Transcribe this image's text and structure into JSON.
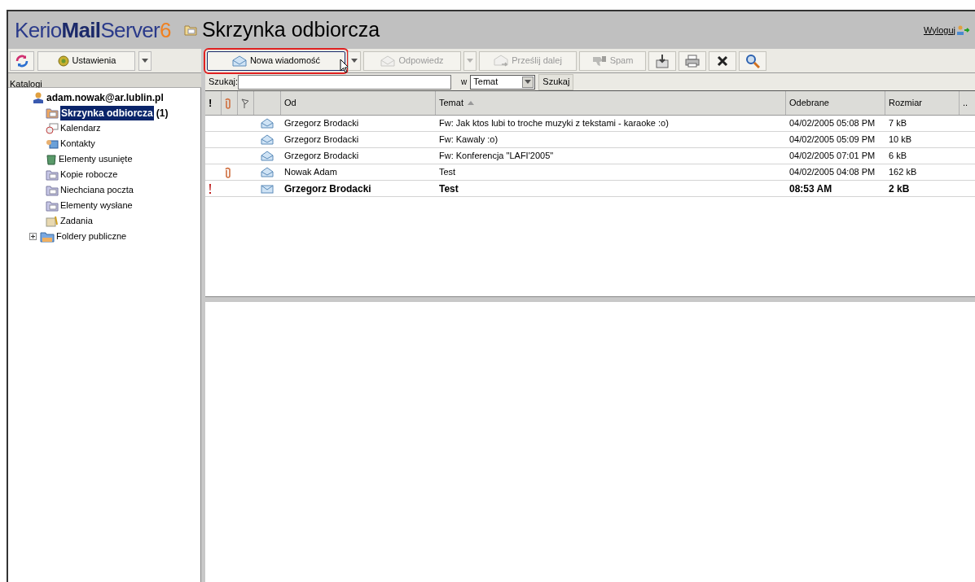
{
  "header": {
    "logo": [
      {
        "text": "Kerio",
        "kind": "plain"
      },
      {
        "text": "Mail",
        "kind": "stylized"
      },
      {
        "text": "Server",
        "kind": "plain"
      },
      {
        "text": "6",
        "kind": "accent"
      }
    ],
    "title": "Skrzynka odbiorcza",
    "logout": "Wyloguj"
  },
  "sidebar": {
    "toolbar": [
      {
        "kind": "refresh"
      },
      {
        "kind": "settings",
        "label": "Ustawienia"
      },
      {
        "kind": "dropdown"
      }
    ],
    "header": "Katalogi",
    "tree": {
      "label": "adam.nowak@ar.lublin.pl",
      "children": [
        {
          "label": "Skrzynka odbiorcza",
          "count": "(1)",
          "kind": "mail-folder",
          "selected": true
        },
        {
          "label": "Kalendarz",
          "kind": "calendar",
          "selected": false
        },
        {
          "label": "Kontakty",
          "kind": "contacts",
          "selected": false
        },
        {
          "label": "Elementy usunięte",
          "kind": "trash",
          "selected": false
        },
        {
          "label": "Kopie robocze",
          "kind": "mail-folder",
          "selected": false
        },
        {
          "label": "Niechciana poczta",
          "kind": "mail-folder",
          "selected": false
        },
        {
          "label": "Elementy wysłane",
          "kind": "mail-folder",
          "selected": false
        },
        {
          "label": "Zadania",
          "kind": "tasks",
          "selected": false
        },
        {
          "label": "Foldery publiczne",
          "kind": "public",
          "selected": false,
          "expanded": false
        }
      ]
    }
  },
  "toolbar": [
    {
      "kind": "new",
      "label": "Nowa wiadomość",
      "disabled": false,
      "highlighted": true
    },
    {
      "kind": "dropdown",
      "disabled": false,
      "highlighted": false
    },
    {
      "kind": "reply",
      "label": "Odpowiedz",
      "disabled": true,
      "highlighted": false
    },
    {
      "kind": "dropdown",
      "disabled": true,
      "highlighted": false
    },
    {
      "kind": "forward",
      "label": "Prześlij dalej",
      "disabled": true,
      "highlighted": false
    },
    {
      "kind": "spam",
      "label": "Spam",
      "disabled": true,
      "highlighted": false
    },
    {
      "kind": "move",
      "disabled": false,
      "highlighted": false
    },
    {
      "kind": "print",
      "disabled": false,
      "highlighted": false
    },
    {
      "kind": "delete",
      "disabled": false,
      "highlighted": false
    },
    {
      "kind": "search",
      "disabled": false,
      "highlighted": false
    }
  ],
  "search": {
    "label": "Szukaj:",
    "in_label": "w",
    "field": "Temat",
    "button": "Szukaj"
  },
  "table": {
    "columns": [
      {
        "kind": "text",
        "label": "!",
        "sorted": false
      },
      {
        "kind": "attachment",
        "sorted": false
      },
      {
        "kind": "flag",
        "sorted": false
      },
      {
        "kind": "type",
        "sorted": false
      },
      {
        "kind": "text",
        "label": "Od",
        "sorted": false
      },
      {
        "kind": "text",
        "label": "Temat",
        "sorted": true
      },
      {
        "kind": "text",
        "label": "Odebrane",
        "sorted": false
      },
      {
        "kind": "text",
        "label": "Rozmiar",
        "sorted": false
      },
      {
        "kind": "text",
        "label": "..",
        "sorted": false
      }
    ],
    "rows": [
      {
        "important": false,
        "attachment": false,
        "unread": false,
        "from": "Grzegorz Brodacki",
        "subject": "Fw: Jak ktos lubi to troche muzyki z tekstami - karaoke :o)",
        "received": "04/02/2005 05:08 PM",
        "size": "7 kB"
      },
      {
        "important": false,
        "attachment": false,
        "unread": false,
        "from": "Grzegorz Brodacki",
        "subject": "Fw: Kawaly :o)",
        "received": "04/02/2005 05:09 PM",
        "size": "10 kB"
      },
      {
        "important": false,
        "attachment": false,
        "unread": false,
        "from": "Grzegorz Brodacki",
        "subject": "Fw: Konferencja \"LAFI'2005\"",
        "received": "04/02/2005 07:01 PM",
        "size": "6 kB"
      },
      {
        "important": false,
        "attachment": true,
        "unread": false,
        "from": "Nowak Adam",
        "subject": "Test",
        "received": "04/02/2005 04:08 PM",
        "size": "162 kB"
      },
      {
        "important": true,
        "attachment": false,
        "unread": true,
        "from": "Grzegorz Brodacki",
        "subject": "Test",
        "received": "08:53 AM",
        "size": "2 kB"
      }
    ]
  }
}
